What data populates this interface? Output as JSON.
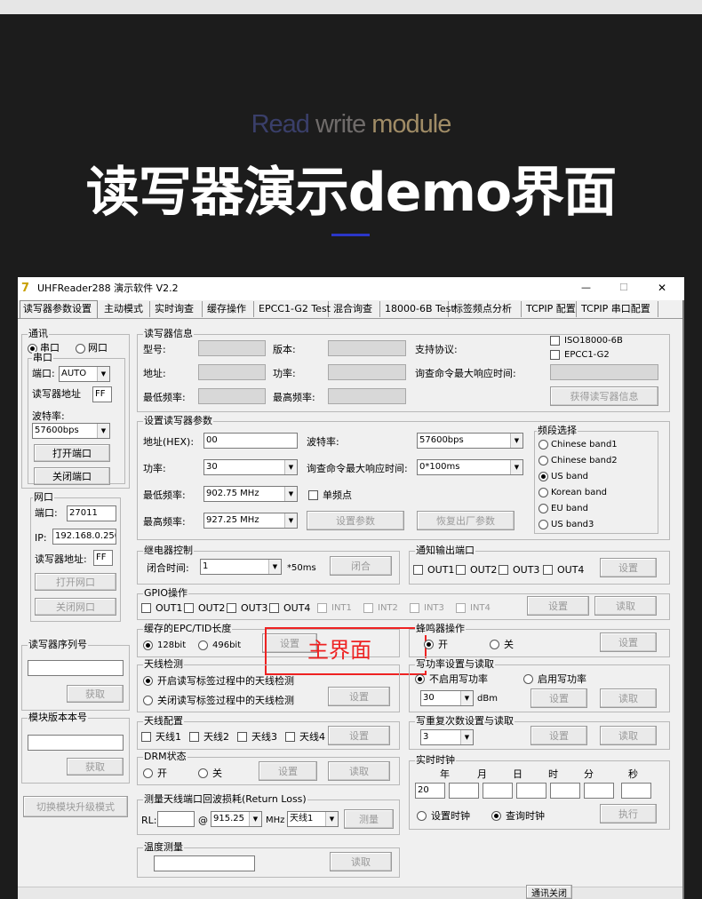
{
  "hero": {
    "sub_a": "Read",
    "sub_b": " write ",
    "sub_c": "module",
    "title": "读写器演示demo界面"
  },
  "window": {
    "title": "UHFReader288 演示软件 V2.2",
    "min": "—",
    "max": "☐",
    "close": "✕"
  },
  "tabs": [
    "读写器参数设置",
    "主动模式",
    "实时询查",
    "缓存操作",
    "EPCC1-G2 Test",
    "混合询查",
    "18000-6B Test",
    "标签频点分析",
    "TCPIP 配置",
    "TCPIP 串口配置"
  ],
  "comm": {
    "title": "通讯",
    "serial_radio": "串口",
    "net_radio": "网口",
    "serial_group": "串口",
    "port_label": "端口:",
    "port_value": "AUTO",
    "addr_label": "读写器地址",
    "addr_value": "FF",
    "baud_label": "波特率:",
    "baud_value": "57600bps",
    "open_port": "打开端口",
    "close_port": "关闭端口"
  },
  "net": {
    "title": "网口",
    "port_label": "端口:",
    "port_value": "27011",
    "ip_label": "IP:",
    "ip_value": "192.168.0.250",
    "addr_label": "读写器地址:",
    "addr_value": "FF",
    "open": "打开网口",
    "close": "关闭网口"
  },
  "serial_no": {
    "title": "读写器序列号",
    "btn": "获取"
  },
  "module_ver": {
    "title": "模块版本本号",
    "btn": "获取"
  },
  "upgrade_btn": "切换模块升级模式",
  "info": {
    "title": "读写器信息",
    "model": "型号:",
    "version": "版本:",
    "protocol": "支持协议:",
    "addr": "地址:",
    "power": "功率:",
    "resp_time": "询查命令最大响应时间:",
    "min_freq": "最低频率:",
    "max_freq": "最高频率:",
    "iso": "ISO18000-6B",
    "epc": "EPCC1-G2",
    "get_btn": "获得读写器信息"
  },
  "setp": {
    "title": "设置读写器参数",
    "addr_label": "地址(HEX):",
    "addr_value": "00",
    "baud_label": "波特率:",
    "baud_value": "57600bps",
    "power_label": "功率:",
    "power_value": "30",
    "resp_label": "询查命令最大响应时间:",
    "resp_value": "0*100ms",
    "min_label": "最低频率:",
    "min_value": "902.75 MHz",
    "single": "单频点",
    "max_label": "最高频率:",
    "max_value": "927.25 MHz",
    "set_btn": "设置参数",
    "reset_btn": "恢复出厂参数"
  },
  "band": {
    "title": "频段选择",
    "items": [
      "Chinese band1",
      "Chinese band2",
      "US band",
      "Korean band",
      "EU band",
      "US band3"
    ]
  },
  "relay": {
    "title": "继电器控制",
    "time_label": "闭合时间:",
    "time_value": "1",
    "unit": "*50ms",
    "btn": "闭合"
  },
  "notify": {
    "title": "通知输出端口",
    "outs": [
      "OUT1",
      "OUT2",
      "OUT3",
      "OUT4"
    ],
    "btn": "设置"
  },
  "gpio": {
    "title": "GPIO操作",
    "outs": [
      "OUT1",
      "OUT2",
      "OUT3",
      "OUT4"
    ],
    "ins": [
      "INT1",
      "INT2",
      "INT3",
      "INT4"
    ],
    "set": "设置",
    "read": "读取"
  },
  "epc_len": {
    "title": "缓存的EPC/TID长度",
    "r1": "128bit",
    "r2": "496bit",
    "set": "设置",
    "overlay": "主界面"
  },
  "buzzer": {
    "title": "蜂鸣器操作",
    "on": "开",
    "off": "关",
    "set": "设置"
  },
  "antdet": {
    "title": "天线检测",
    "opt1": "开启读写标签过程中的天线检测",
    "opt2": "关闭读写标签过程中的天线检测",
    "set": "设置"
  },
  "wpower": {
    "title": "写功率设置与读取",
    "opt1": "不启用写功率",
    "opt2": "启用写功率",
    "value": "30",
    "unit": "dBm",
    "set": "设置",
    "read": "读取"
  },
  "antcfg": {
    "title": "天线配置",
    "items": [
      "天线1",
      "天线2",
      "天线3",
      "天线4"
    ],
    "set": "设置"
  },
  "retry": {
    "title": "写重复次数设置与读取",
    "value": "3",
    "set": "设置",
    "read": "读取"
  },
  "drm": {
    "title": "DRM状态",
    "on": "开",
    "off": "关",
    "set": "设置",
    "read": "读取"
  },
  "clock": {
    "title": "实时时钟",
    "labels": [
      "年",
      "月",
      "日",
      "时",
      "分",
      "秒"
    ],
    "year": "20",
    "set_opt": "设置时钟",
    "query_opt": "查询时钟",
    "exec": "执行"
  },
  "rl": {
    "title": "测量天线端口回波损耗(Return Loss)",
    "rl_label": "RL:",
    "at": "@",
    "freq": "915.25",
    "mhz": "MHz",
    "ant": "天线1",
    "btn": "测量"
  },
  "temp": {
    "title": "温度测量",
    "btn": "读取"
  },
  "status_btn": "通讯关闭"
}
